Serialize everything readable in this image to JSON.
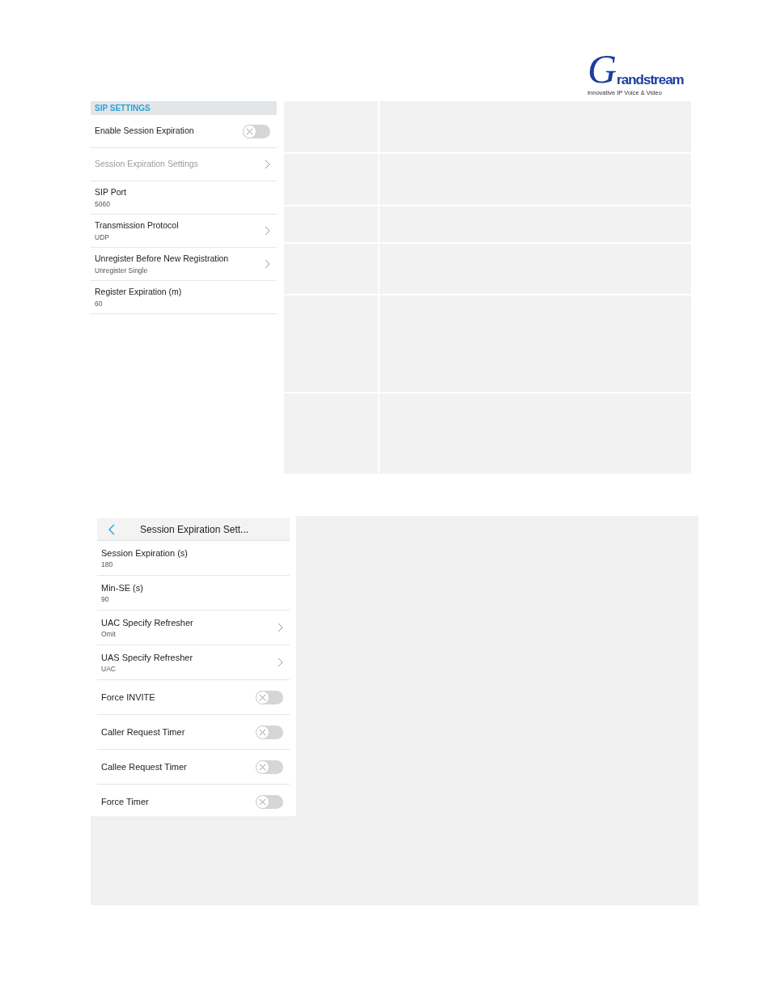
{
  "logo": {
    "initial": "G",
    "name": "randstream",
    "tagline": "Innovative IP Voice & Video"
  },
  "sip_settings": {
    "header": "SIP SETTINGS",
    "rows": [
      {
        "kind": "toggle",
        "label": "Enable Session Expiration",
        "on": false,
        "disabled": false
      },
      {
        "kind": "link",
        "label": "Session Expiration Settings",
        "disabled": true
      },
      {
        "kind": "value",
        "label": "SIP Port",
        "value": "5060",
        "disabled": false
      },
      {
        "kind": "link",
        "label": "Transmission Protocol",
        "value": "UDP",
        "disabled": false
      },
      {
        "kind": "link",
        "label": "Unregister Before New Registration",
        "value": "Unregister Single",
        "disabled": false
      },
      {
        "kind": "value",
        "label": "Register Expiration (m)",
        "value": "60",
        "disabled": false
      }
    ]
  },
  "session_expiration": {
    "title": "Session Expiration Sett...",
    "rows": [
      {
        "kind": "value",
        "label": "Session Expiration (s)",
        "value": "180"
      },
      {
        "kind": "value",
        "label": "Min-SE (s)",
        "value": "90"
      },
      {
        "kind": "link",
        "label": "UAC Specify Refresher",
        "value": "Omit"
      },
      {
        "kind": "link",
        "label": "UAS Specify Refresher",
        "value": "UAC"
      },
      {
        "kind": "toggle",
        "label": "Force INVITE",
        "on": false
      },
      {
        "kind": "toggle",
        "label": "Caller Request Timer",
        "on": false
      },
      {
        "kind": "toggle",
        "label": "Callee Request Timer",
        "on": false
      },
      {
        "kind": "toggle",
        "label": "Force Timer",
        "on": false
      }
    ]
  }
}
